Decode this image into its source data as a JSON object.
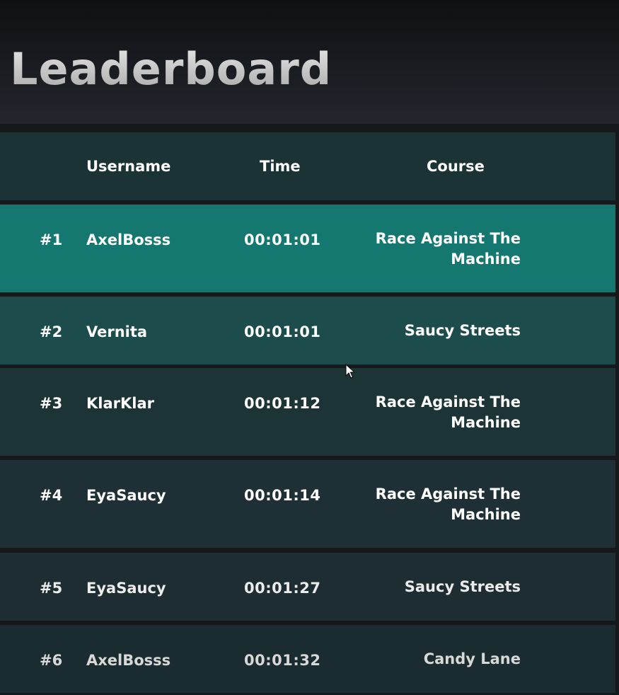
{
  "title": "Leaderboard",
  "columns": {
    "username": "Username",
    "time": "Time",
    "course": "Course"
  },
  "rows": [
    {
      "rank": "#1",
      "username": "AxelBosss",
      "time": "00:01:01",
      "course": "Race Against The Machine"
    },
    {
      "rank": "#2",
      "username": "Vernita",
      "time": "00:01:01",
      "course": "Saucy Streets"
    },
    {
      "rank": "#3",
      "username": "KlarKlar",
      "time": "00:01:12",
      "course": "Race Against The Machine"
    },
    {
      "rank": "#4",
      "username": "EyaSaucy",
      "time": "00:01:14",
      "course": "Race Against The Machine"
    },
    {
      "rank": "#5",
      "username": "EyaSaucy",
      "time": "00:01:27",
      "course": "Saucy Streets"
    },
    {
      "rank": "#6",
      "username": "AxelBosss",
      "time": "00:01:32",
      "course": "Candy Lane"
    }
  ],
  "colors": {
    "highlight_row": "#157870",
    "second_row": "#1c4c4c",
    "row": "#1d3437",
    "text": "#ffffff",
    "title": "#c9c9c9"
  },
  "icons": {
    "cursor": "mouse-pointer-icon"
  }
}
